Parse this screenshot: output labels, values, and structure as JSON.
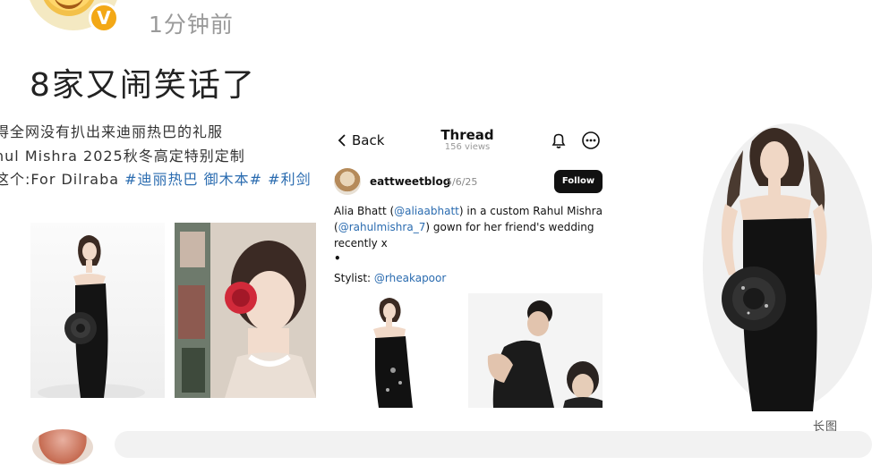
{
  "post": {
    "time": "1分钟前",
    "title": "8家又闹笑话了",
    "lines": [
      "得全网没有扒出来迪丽热巴的礼服",
      "hul Mishra 2025秋冬高定特别定制",
      "这个:For Dilraba "
    ],
    "hashtags": [
      "#迪丽热巴",
      "御木本#",
      "#利剑"
    ],
    "verified_badge": "V"
  },
  "thread": {
    "back_label": "Back",
    "title": "Thread",
    "views": "156 views",
    "author_handle": "eattweetblog",
    "date": "5/6/25",
    "follow_label": "Follow",
    "text": {
      "line1_pre": "Alia Bhatt (",
      "mention1": "@aliaabhatt",
      "line1_post": ") in a custom Rahul Mishra",
      "line2_pre": "(",
      "mention2": "@rahulmishra_7",
      "line2_post": ") gown for her friend's wedding",
      "line3": "recently x",
      "bullet": "•",
      "stylist_label": "Stylist: ",
      "stylist_mention": "@rheakapoor"
    }
  },
  "long_image_label": "长图",
  "icons": [
    "verified-badge-icon",
    "chevron-left-icon",
    "bell-icon",
    "more-icon"
  ]
}
